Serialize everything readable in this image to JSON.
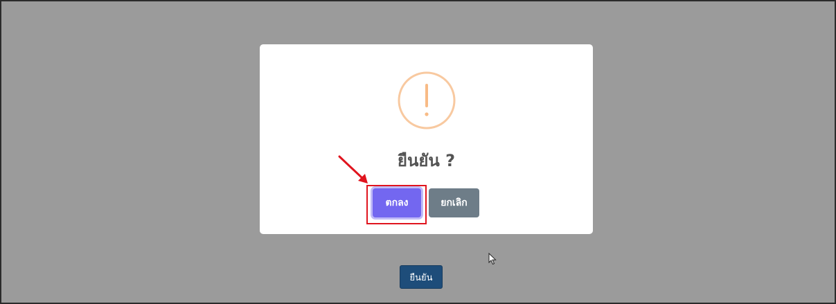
{
  "page": {
    "confirm_button_label": "ยืนยัน"
  },
  "modal": {
    "icon": "warning-exclamation-icon",
    "icon_color": "#f8bb86",
    "title": "ยืนยัน ?",
    "ok_label": "ตกลง",
    "cancel_label": "ยกเลิก",
    "ok_color": "#7367f0",
    "cancel_color": "#6e7d88"
  },
  "annotation": {
    "highlight_color": "#e0141e"
  }
}
